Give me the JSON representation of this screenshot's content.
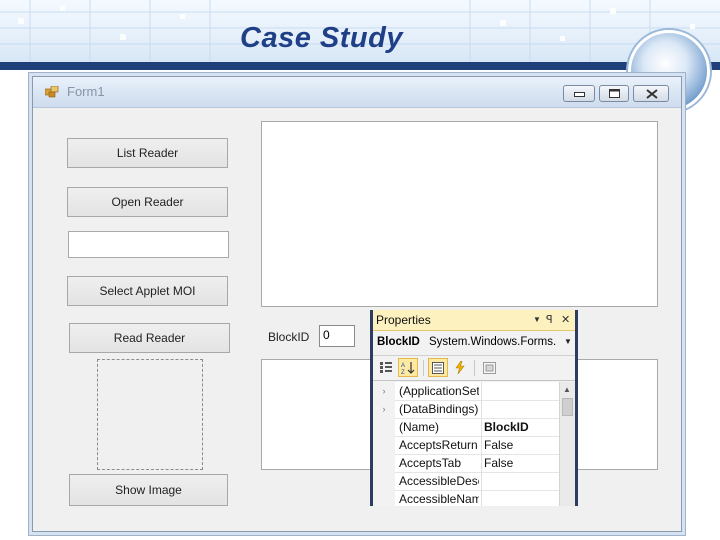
{
  "slide": {
    "title": "Case Study"
  },
  "window": {
    "title": "Form1"
  },
  "buttons": {
    "list_reader": "List Reader",
    "open_reader": "Open Reader",
    "select_applet": "Select Applet MOI",
    "read_reader": "Read Reader",
    "show_image": "Show Image"
  },
  "blockid": {
    "label": "BlockID",
    "value": "0"
  },
  "properties": {
    "title": "Properties",
    "pin_glyph": "▾ ꟼ ✕",
    "selected_object": "BlockID",
    "selected_type": "System.Windows.Forms.",
    "rows": [
      {
        "name": "(ApplicationSet",
        "value": "",
        "expandable": true
      },
      {
        "name": "(DataBindings)",
        "value": "",
        "expandable": true
      },
      {
        "name": "(Name)",
        "value": "BlockID",
        "bold": true
      },
      {
        "name": "AcceptsReturn",
        "value": "False"
      },
      {
        "name": "AcceptsTab",
        "value": "False"
      },
      {
        "name": "AccessibleDesc",
        "value": ""
      },
      {
        "name": "AccessibleNam",
        "value": ""
      }
    ]
  },
  "icons": [
    "app-icon",
    "minimize-icon",
    "maximize-icon",
    "close-icon",
    "dropdown-arrow-icon",
    "pin-icon",
    "categorized-icon",
    "alphabetical-icon",
    "properties-icon",
    "events-icon",
    "property-pages-icon",
    "expand-chevron-icon",
    "globe-logo"
  ],
  "colors": {
    "header_band": "#1e3f7a",
    "title": "#1f3f86",
    "properties_title_bg": "#fdf1bf",
    "properties_border": "#2b3d63"
  }
}
